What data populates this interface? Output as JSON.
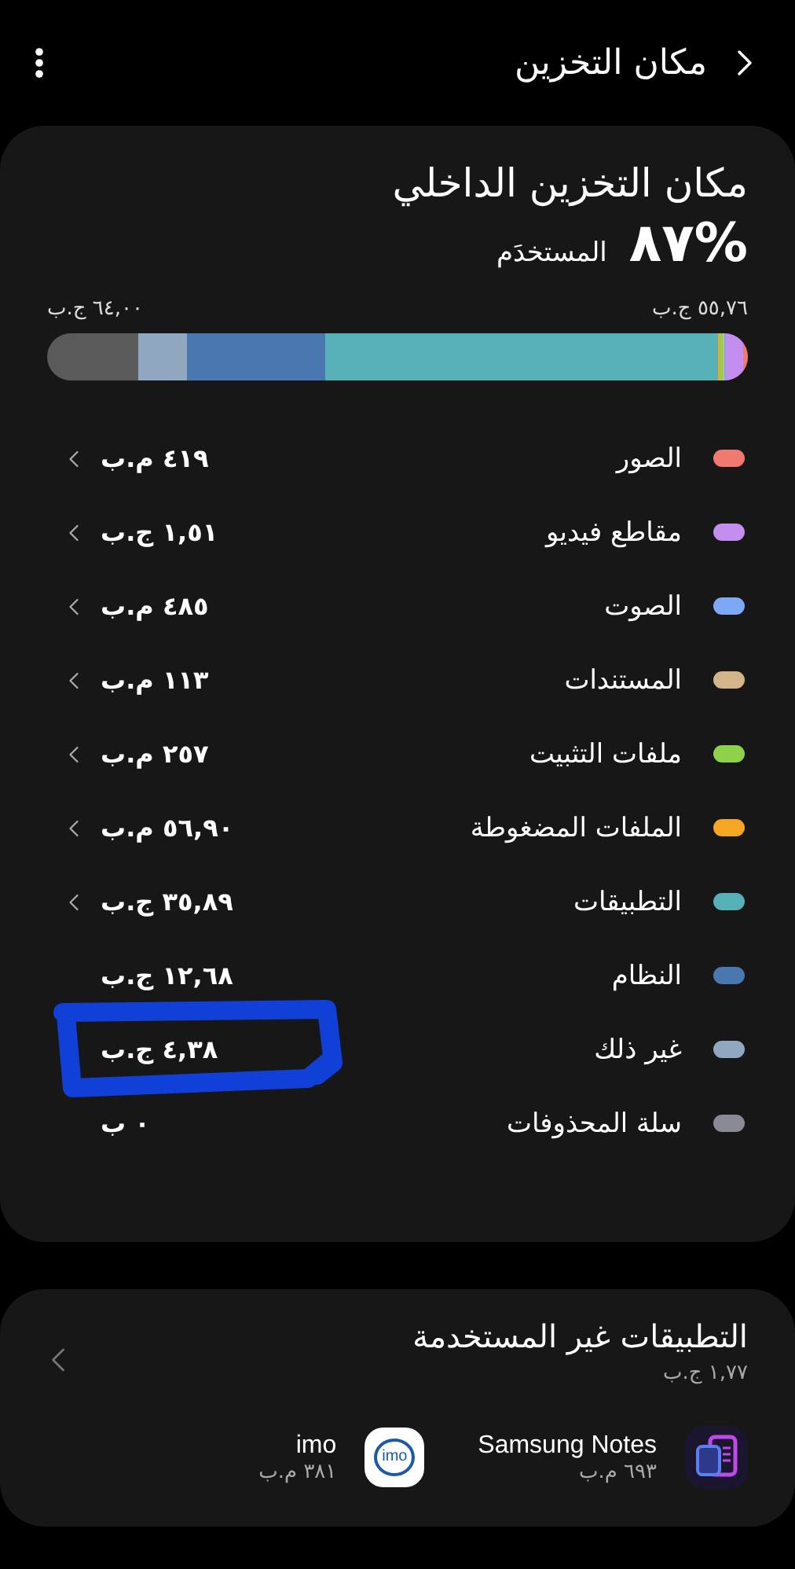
{
  "header": {
    "title": "مكان التخزين"
  },
  "storage": {
    "title": "مكان التخزين الداخلي",
    "percent": "%٨٧",
    "used_label": "المستخدَم",
    "used_amount": "٥٥,٧٦ ج.ب",
    "total_amount": "٦٤,٠٠ ج.ب",
    "categories": [
      {
        "name": "الصور",
        "size": "٤١٩ م.ب",
        "color": "#f07a70",
        "chevron": true,
        "highlighted": false
      },
      {
        "name": "مقاطع فيديو",
        "size": "١,٥١ ج.ب",
        "color": "#c48ef0",
        "chevron": true,
        "highlighted": false
      },
      {
        "name": "الصوت",
        "size": "٤٨٥ م.ب",
        "color": "#7ea8f5",
        "chevron": true,
        "highlighted": false
      },
      {
        "name": "المستندات",
        "size": "١١٣ م.ب",
        "color": "#d3b58a",
        "chevron": true,
        "highlighted": false
      },
      {
        "name": "ملفات التثبيت",
        "size": "٢٥٧ م.ب",
        "color": "#8fd14a",
        "chevron": true,
        "highlighted": false
      },
      {
        "name": "الملفات المضغوطة",
        "size": "٥٦,٩٠ م.ب",
        "color": "#f5a623",
        "chevron": true,
        "highlighted": false
      },
      {
        "name": "التطبيقات",
        "size": "٣٥,٨٩ ج.ب",
        "color": "#55b0b8",
        "chevron": true,
        "highlighted": false
      },
      {
        "name": "النظام",
        "size": "١٢,٦٨ ج.ب",
        "color": "#4a77b0",
        "chevron": false,
        "highlighted": false
      },
      {
        "name": "غير ذلك",
        "size": "٤,٣٨ ج.ب",
        "color": "#8fa8bf",
        "chevron": false,
        "highlighted": true
      },
      {
        "name": "سلة المحذوفات",
        "size": "٠ ب",
        "color": "#8a8a96",
        "chevron": false,
        "highlighted": false
      }
    ]
  },
  "unused_apps": {
    "title": "التطبيقات غير المستخدمة",
    "size": "١,٧٧ ج.ب",
    "apps": [
      {
        "kind": "notes",
        "name": "Samsung Notes",
        "size": "٦٩٣ م.ب"
      },
      {
        "kind": "chat",
        "name": "imo",
        "size": "٣٨١ م.ب",
        "icon_text": "imo"
      }
    ]
  }
}
